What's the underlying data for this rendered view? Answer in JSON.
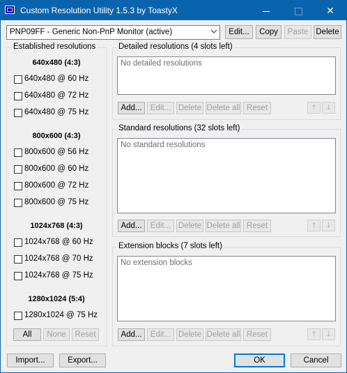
{
  "window": {
    "title": "Custom Resolution Utility 1.5.3 by ToastyX"
  },
  "monitor": {
    "selected": "PNP09FF - Generic Non-PnP Monitor (active)",
    "edit_label": "Edit...",
    "copy_label": "Copy",
    "paste_label": "Paste",
    "delete_label": "Delete"
  },
  "established": {
    "title": "Established resolutions",
    "groups": [
      {
        "header": "640x480 (4:3)",
        "items": [
          "640x480 @ 60 Hz",
          "640x480 @ 72 Hz",
          "640x480 @ 75 Hz"
        ]
      },
      {
        "header": "800x600 (4:3)",
        "items": [
          "800x600 @ 56 Hz",
          "800x600 @ 60 Hz",
          "800x600 @ 72 Hz",
          "800x600 @ 75 Hz"
        ]
      },
      {
        "header": "1024x768 (4:3)",
        "items": [
          "1024x768 @ 60 Hz",
          "1024x768 @ 70 Hz",
          "1024x768 @ 75 Hz"
        ]
      },
      {
        "header": "1280x1024 (5:4)",
        "items": [
          "1280x1024 @ 75 Hz"
        ]
      }
    ],
    "all_label": "All",
    "none_label": "None",
    "reset_label": "Reset"
  },
  "detailed": {
    "title": "Detailed resolutions (4 slots left)",
    "empty_text": "No detailed resolutions",
    "add_label": "Add...",
    "edit_label": "Edit...",
    "delete_label": "Delete",
    "delete_all_label": "Delete all",
    "reset_label": "Reset"
  },
  "standard": {
    "title": "Standard resolutions (32 slots left)",
    "empty_text": "No standard resolutions",
    "add_label": "Add...",
    "edit_label": "Edit...",
    "delete_label": "Delete",
    "delete_all_label": "Delete all",
    "reset_label": "Reset"
  },
  "extension": {
    "title": "Extension blocks (7 slots left)",
    "empty_text": "No extension blocks",
    "add_label": "Add...",
    "edit_label": "Edit...",
    "delete_label": "Delete",
    "delete_all_label": "Delete all",
    "reset_label": "Reset"
  },
  "footer": {
    "import_label": "Import...",
    "export_label": "Export...",
    "ok_label": "OK",
    "cancel_label": "Cancel"
  },
  "colors": {
    "titlebar": "#0a64ad",
    "default_button_border": "#0078d7"
  }
}
